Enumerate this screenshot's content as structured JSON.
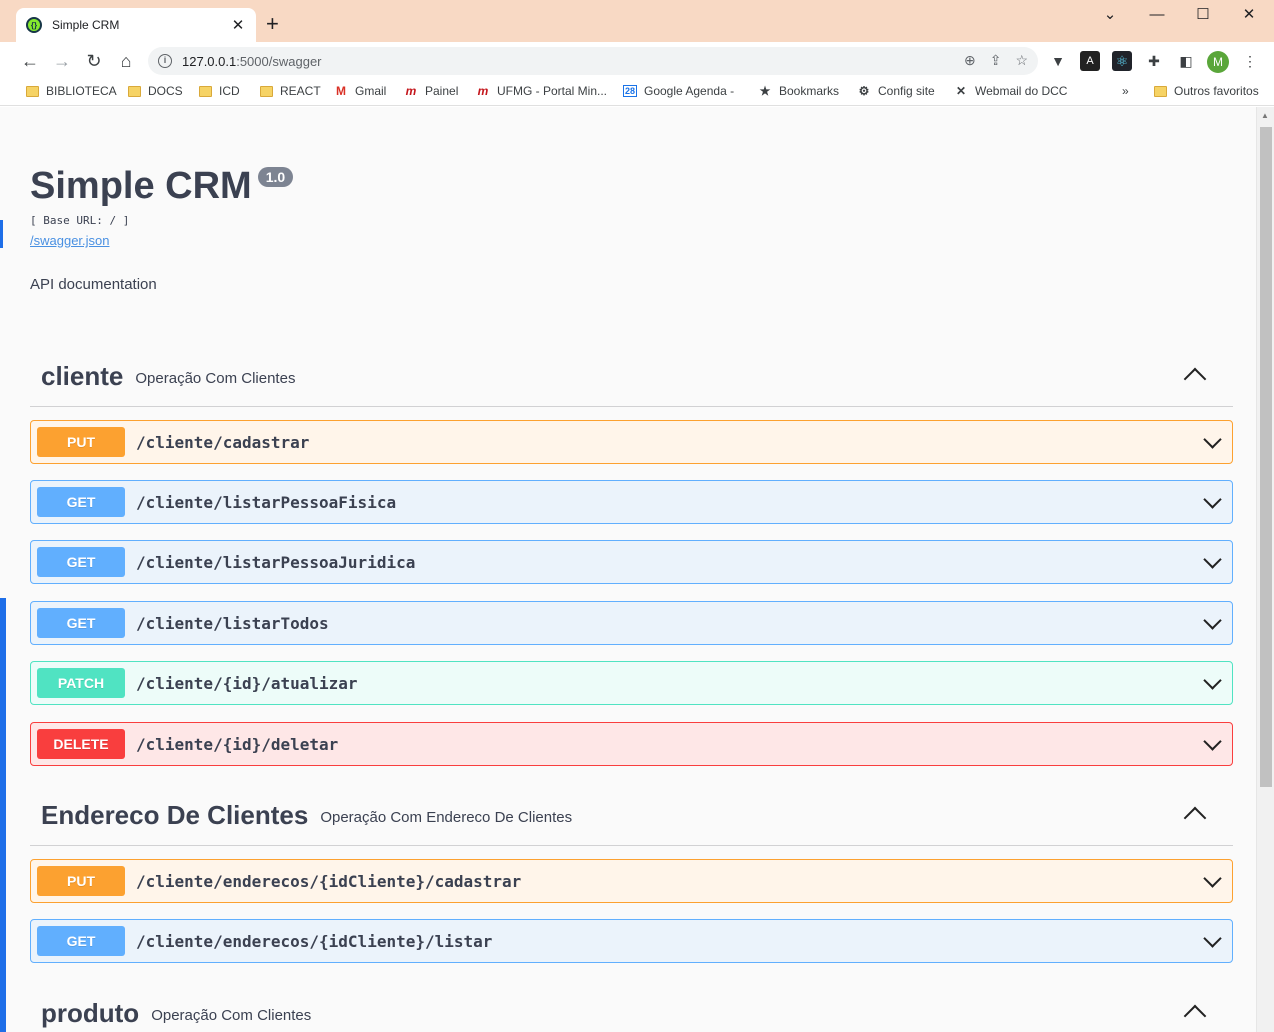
{
  "browser": {
    "tab_title": "Simple CRM",
    "tab_close": "✕",
    "new_tab": "+",
    "url_host": "127.0.0.1",
    "url_path": ":5000/swagger",
    "profile_initial": "M",
    "bookmarks": [
      {
        "label": "BIBLIOTECA",
        "icon": "folder-icon"
      },
      {
        "label": "DOCS",
        "icon": "folder-icon"
      },
      {
        "label": "ICD",
        "icon": "folder-icon"
      },
      {
        "label": "REACT",
        "icon": "folder-icon"
      },
      {
        "label": "Gmail",
        "icon": "gmail-icon"
      },
      {
        "label": "Painel",
        "icon": "ufmg-icon"
      },
      {
        "label": "UFMG - Portal Min...",
        "icon": "ufmg-icon"
      },
      {
        "label": "Google Agenda -",
        "icon": "calendar-icon"
      },
      {
        "label": "Bookmarks",
        "icon": "star-icon"
      },
      {
        "label": "Config site",
        "icon": "gear-icon"
      },
      {
        "label": "Webmail do DCC",
        "icon": "webmail-icon"
      }
    ],
    "bookmarks_overflow": "»",
    "other_bookmarks": "Outros favoritos"
  },
  "info": {
    "title": "Simple CRM",
    "version": "1.0",
    "base_url": "[ Base URL: / ]",
    "spec_link": "/swagger.json",
    "description": "API documentation"
  },
  "tags": [
    {
      "name": "cliente",
      "description": "Operação Com Clientes",
      "operations": [
        {
          "method": "PUT",
          "path": "/cliente/cadastrar"
        },
        {
          "method": "GET",
          "path": "/cliente/listarPessoaFisica"
        },
        {
          "method": "GET",
          "path": "/cliente/listarPessoaJuridica"
        },
        {
          "method": "GET",
          "path": "/cliente/listarTodos"
        },
        {
          "method": "PATCH",
          "path": "/cliente/{id}/atualizar"
        },
        {
          "method": "DELETE",
          "path": "/cliente/{id}/deletar"
        }
      ]
    },
    {
      "name": "Endereco De Clientes",
      "description": "Operação Com Endereco De Clientes",
      "operations": [
        {
          "method": "PUT",
          "path": "/cliente/enderecos/{idCliente}/cadastrar"
        },
        {
          "method": "GET",
          "path": "/cliente/enderecos/{idCliente}/listar"
        }
      ]
    },
    {
      "name": "produto",
      "description": "Operação Com Clientes",
      "operations": []
    }
  ],
  "colors": {
    "PUT": {
      "badge": "#fca130",
      "bg": "#fff5ea",
      "border": "#fca130"
    },
    "GET": {
      "badge": "#61affe",
      "bg": "#ebf3fb",
      "border": "#61affe"
    },
    "PATCH": {
      "badge": "#50e3c2",
      "bg": "#edfcf9",
      "border": "#50e3c2"
    },
    "DELETE": {
      "badge": "#f93e3e",
      "bg": "#fee7e7",
      "border": "#f93e3e"
    }
  }
}
